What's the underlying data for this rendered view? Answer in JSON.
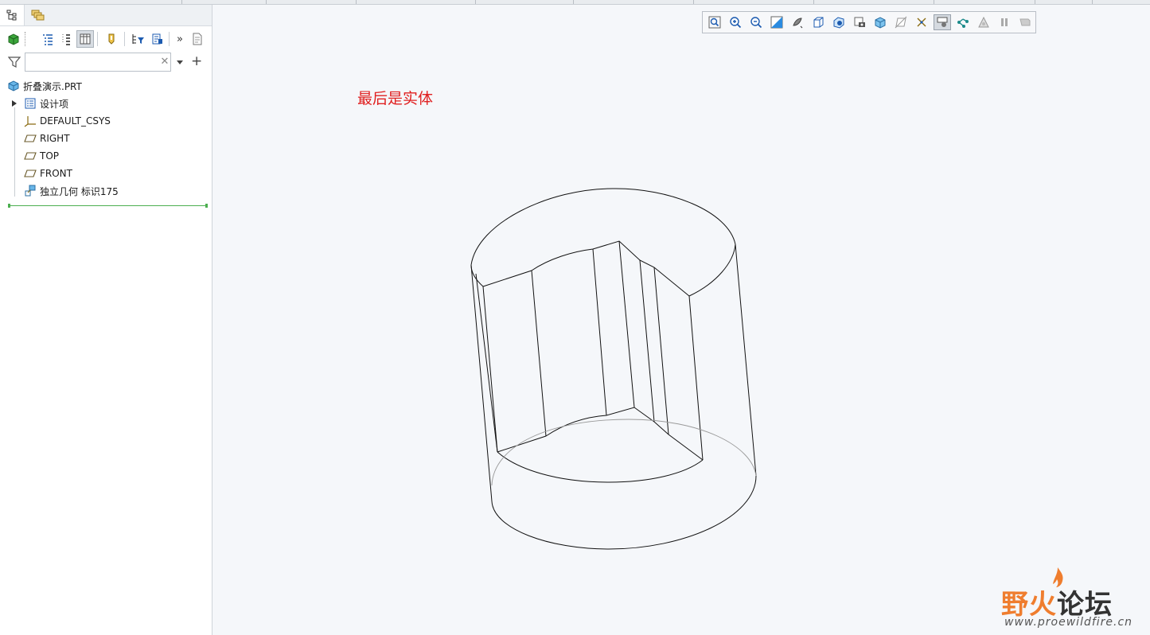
{
  "model_tree": {
    "search_placeholder": "",
    "items": [
      {
        "label": "折叠演示.PRT",
        "icon": "part-icon"
      },
      {
        "label": "设计项",
        "icon": "design-items-icon"
      },
      {
        "label": "DEFAULT_CSYS",
        "icon": "csys-icon"
      },
      {
        "label": "RIGHT",
        "icon": "datum-plane-icon"
      },
      {
        "label": "TOP",
        "icon": "datum-plane-icon"
      },
      {
        "label": "FRONT",
        "icon": "datum-plane-icon"
      },
      {
        "label": "独立几何 标识175",
        "icon": "independent-geometry-icon"
      }
    ]
  },
  "annotation": "最后是实体",
  "watermark": {
    "title_part1": "野火",
    "title_part2": "论坛",
    "url": "www.proewildfire.cn"
  },
  "colors": {
    "annotation": "#e02020",
    "background": "#f5f7fa",
    "insert_line": "#4caf50"
  }
}
